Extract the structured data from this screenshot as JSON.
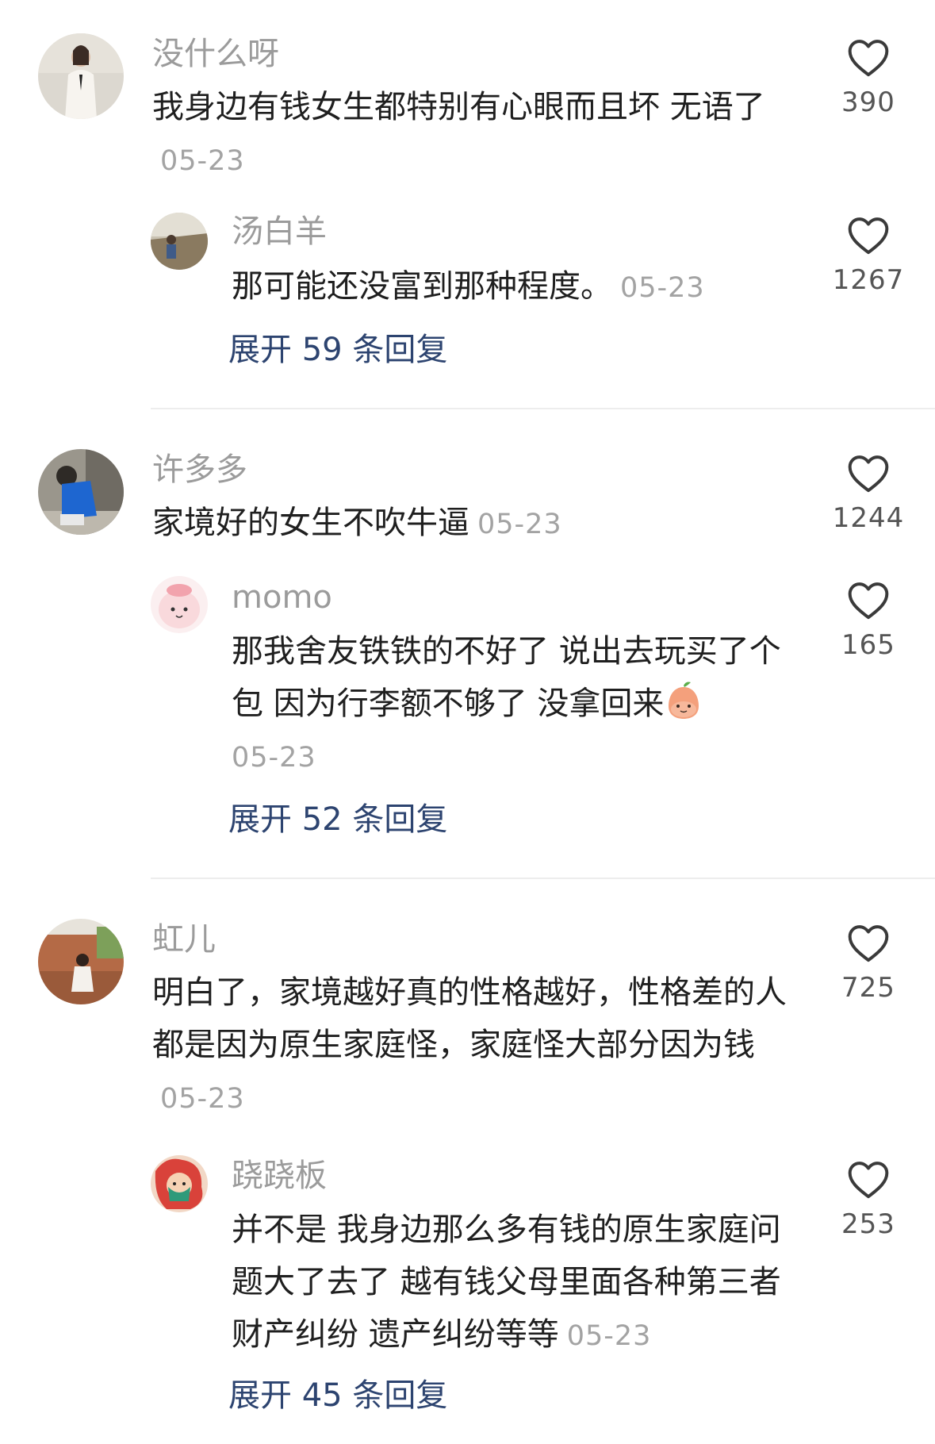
{
  "threads": [
    {
      "comment": {
        "user": "没什么呀",
        "text": "我身边有钱女生都特别有心眼而且坏 无语了",
        "date": "05-23",
        "likes": "390"
      },
      "reply": {
        "user": "汤白羊",
        "text": "那可能还没富到那种程度。",
        "date": "05-23",
        "likes": "1267"
      },
      "expand_label": "展开 59 条回复"
    },
    {
      "comment": {
        "user": "许多多",
        "text": "家境好的女生不吹牛逼",
        "date": "05-23",
        "likes": "1244"
      },
      "reply": {
        "user": "momo",
        "text": "那我舍友铁铁的不好了 说出去玩买了个包 因为行李额不够了 没拿回来",
        "emoji": "peach-face-emoji",
        "date": "05-23",
        "likes": "165"
      },
      "expand_label": "展开 52 条回复"
    },
    {
      "comment": {
        "user": "虹儿",
        "text": "明白了，家境越好真的性格越好，性格差的人都是因为原生家庭怪，家庭怪大部分因为钱",
        "date": "05-23",
        "likes": "725"
      },
      "reply": {
        "user": "跷跷板",
        "text": "并不是 我身边那么多有钱的原生家庭问题大了去了 越有钱父母里面各种第三者财产纠纷 遗产纠纷等等",
        "date": "05-23",
        "likes": "253"
      },
      "expand_label": "展开 45 条回复"
    }
  ],
  "icons": {
    "like": "heart-outline-icon"
  },
  "colors": {
    "username": "#9b9b9b",
    "text": "#1f1f1f",
    "date": "#a3a3a3",
    "expand_link": "#2d4470",
    "like_icon": "#3a3a3a",
    "divider": "#ededed"
  }
}
